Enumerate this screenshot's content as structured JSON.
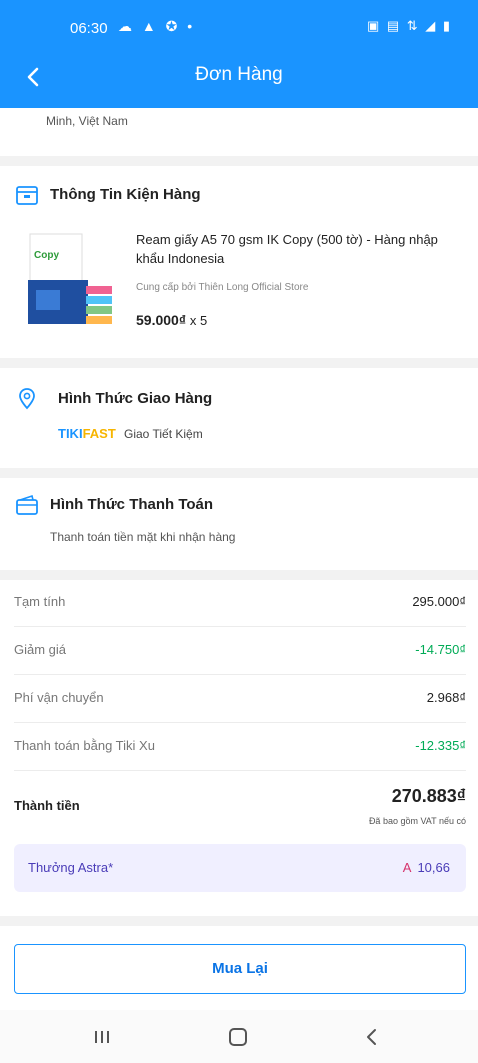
{
  "status_bar": {
    "time": "06:30",
    "left_icons": "☁ ▲ ✪ •",
    "right_icons": "▣ ▤ ⇅ ◢ ▮"
  },
  "appbar": {
    "title": "Đơn Hàng"
  },
  "address": {
    "tail": "Minh, Việt Nam"
  },
  "package": {
    "title": "Thông Tin Kiện Hàng",
    "product_name": "Ream giấy A5 70 gsm IK Copy (500 tờ) - Hàng nhập khẩu Indonesia",
    "store": "Cung cấp bởi Thiên Long Official Store",
    "price": "59.000₫",
    "qty": "x 5"
  },
  "shipping": {
    "title": "Hình Thức Giao Hàng",
    "brand_a": "TIKI",
    "brand_b": "FAST",
    "desc": "Giao Tiết Kiệm"
  },
  "payment": {
    "title": "Hình Thức Thanh Toán",
    "desc": "Thanh toán tiền mặt khi nhận hàng"
  },
  "summary": {
    "rows": [
      {
        "label": "Tạm tính",
        "value": "295.000₫"
      },
      {
        "label": "Giảm giá",
        "value": "-14.750₫"
      },
      {
        "label": "Phí vận chuyển",
        "value": "2.968₫"
      },
      {
        "label": "Thanh toán bằng Tiki Xu",
        "value": "-12.335₫"
      }
    ],
    "total_label": "Thành tiền",
    "total_value": "270.883₫",
    "vat_note": "Đã bao gồm VAT nếu có",
    "astra_label": "Thưởng Astra*",
    "astra_value": "10,66"
  },
  "actions": {
    "rebuy_label": "Mua Lại"
  },
  "colors": {
    "primary": "#1a94ff",
    "discount": "#00ab56",
    "astra": "#4a3cb8"
  }
}
